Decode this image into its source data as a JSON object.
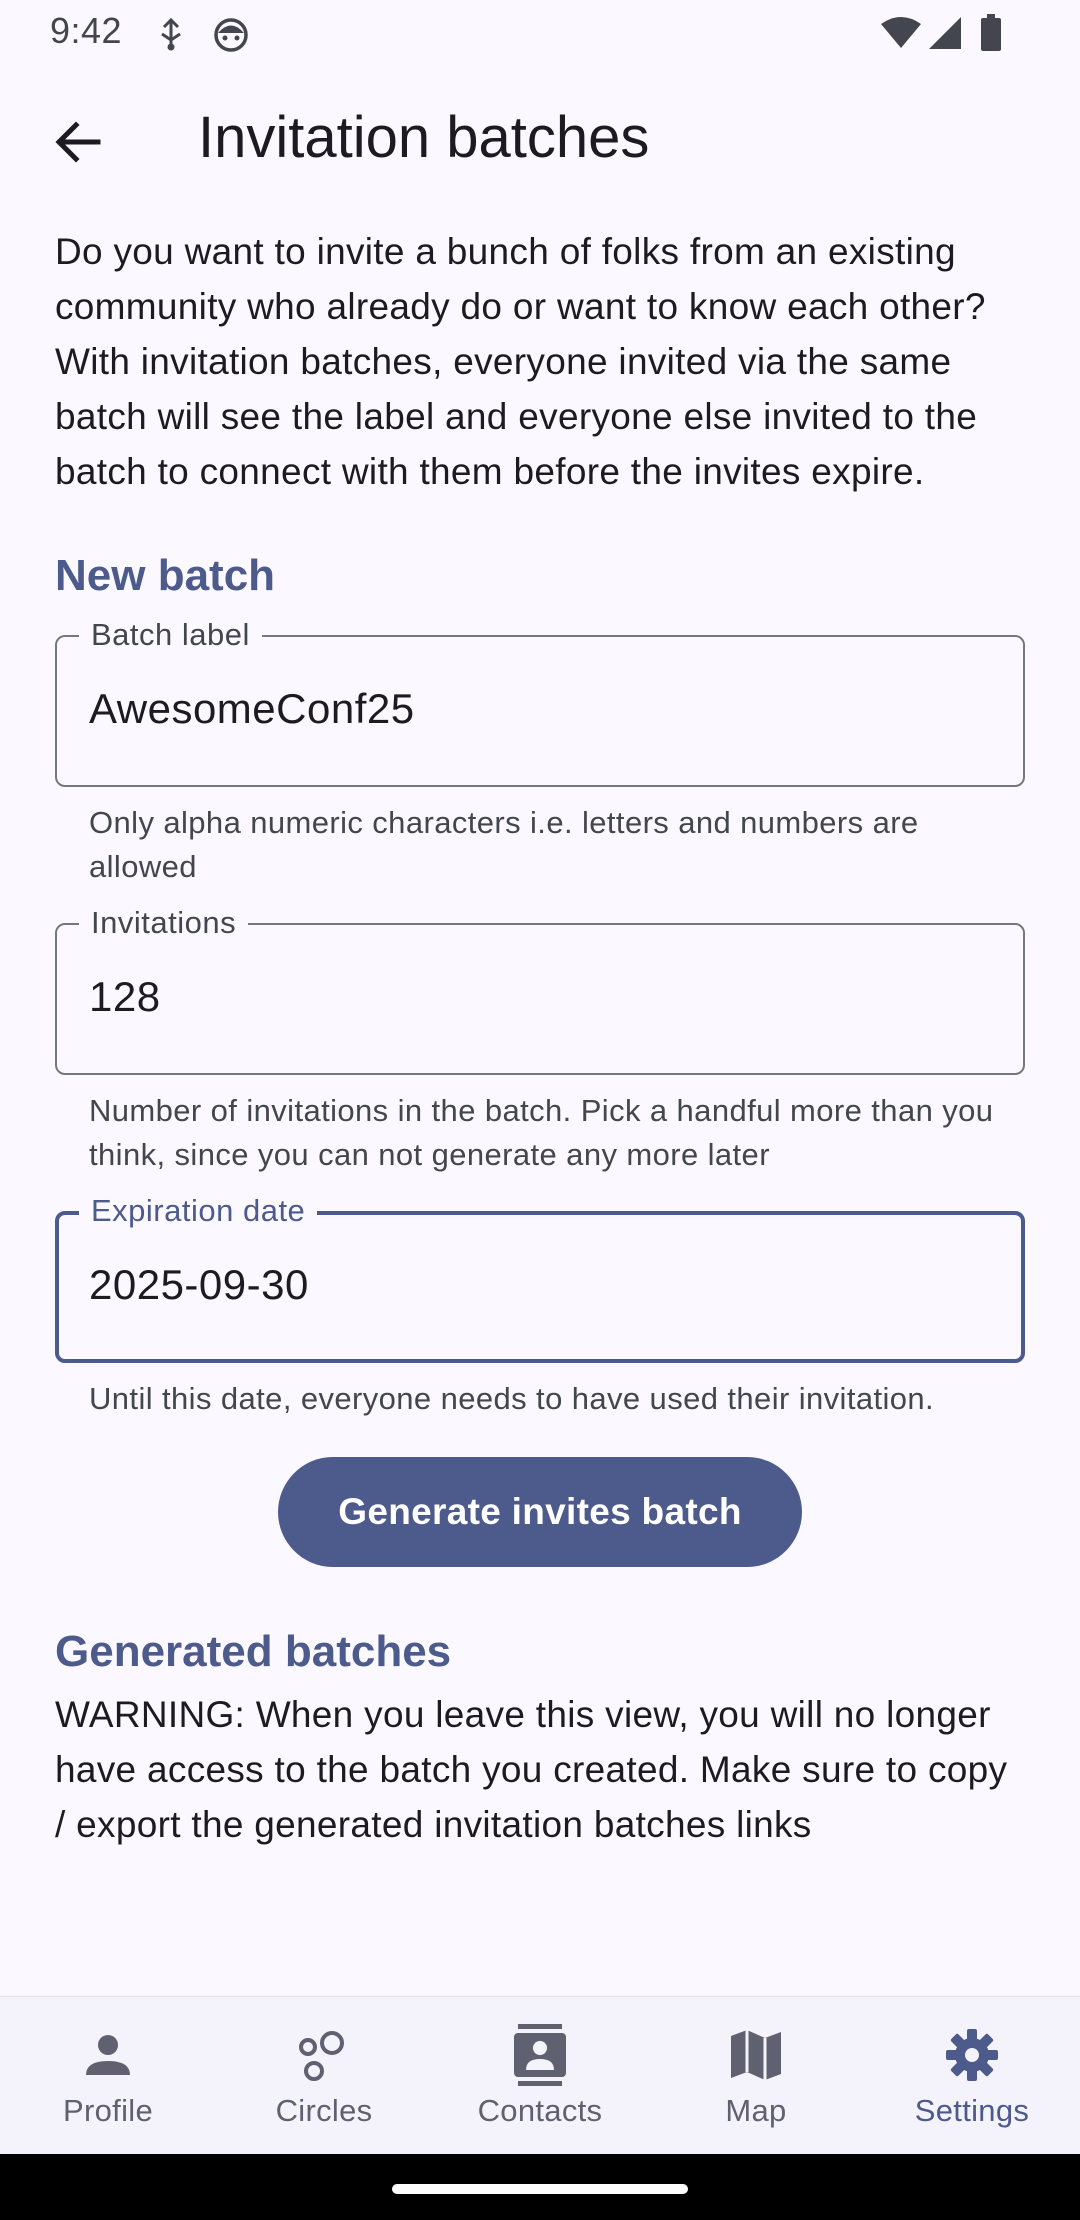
{
  "status_bar": {
    "time": "9:42",
    "icons": [
      "usb-debug-icon",
      "android-icon",
      "wifi-icon",
      "signal-icon",
      "battery-icon"
    ]
  },
  "app_bar": {
    "back_icon": "arrow-back-icon",
    "title": "Invitation batches"
  },
  "intro": {
    "line1": "Do you want to invite a bunch of folks from an existing community who already do or want to know each other?",
    "line2": "With invitation batches, everyone invited via the same batch will see the label and everyone else invited to the batch to connect with them before the invites expire."
  },
  "new_batch": {
    "title": "New batch",
    "batch_label": {
      "label": "Batch label",
      "value": "AwesomeConf25",
      "helper": "Only alpha numeric characters i.e. letters and numbers are allowed"
    },
    "invitations": {
      "label": "Invitations",
      "value": "128",
      "helper": "Number of invitations in the batch. Pick a handful more than you think, since you can not generate any more later"
    },
    "expiration": {
      "label": "Expiration date",
      "value": "2025-09-30",
      "helper": "Until this date, everyone needs to have used their invitation."
    },
    "generate_button": "Generate invites batch"
  },
  "generated": {
    "title": "Generated batches",
    "warning": "WARNING: When you leave this view, you will no longer have access to the batch you created. Make sure to copy / export the generated invitation batches links"
  },
  "bottom_nav": {
    "items": [
      {
        "label": "Profile",
        "icon": "person-icon",
        "active": false
      },
      {
        "label": "Circles",
        "icon": "circles-icon",
        "active": false
      },
      {
        "label": "Contacts",
        "icon": "contacts-icon",
        "active": false
      },
      {
        "label": "Map",
        "icon": "map-icon",
        "active": false
      },
      {
        "label": "Settings",
        "icon": "gear-icon",
        "active": true
      }
    ]
  },
  "colors": {
    "accent": "#4d5a8c",
    "background": "#fbf8ff",
    "nav_background": "#f4f2fa",
    "outline": "#757780",
    "text_secondary": "#44464f"
  }
}
